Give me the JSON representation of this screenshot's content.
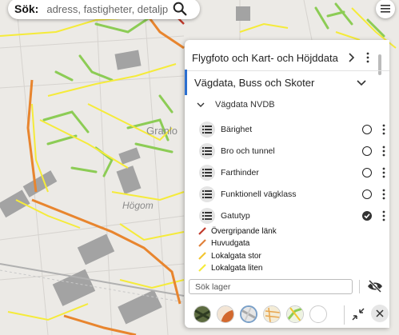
{
  "search": {
    "label": "Sök:",
    "placeholder": "adress, fastigheter, detaljplaner"
  },
  "map": {
    "place_labels": [
      "Granlo",
      "Högom"
    ],
    "colors": {
      "background": "#eceae6",
      "building": "#9c9c9c",
      "road_yellow": "#f5eb3a",
      "road_orange": "#f0a040",
      "road_red": "#c0392b",
      "vegetation_green": "#8ccc55",
      "accent_blue": "#2b6fd0"
    }
  },
  "panel": {
    "groups": [
      {
        "label": "Flygfoto och Kart- och Höjddata",
        "icon": "chevron-right-icon"
      },
      {
        "label": "Vägdata, Buss och Skoter",
        "icon": "chevron-down-icon"
      }
    ],
    "subgroup": {
      "label": "Vägdata NVDB",
      "icon": "chevron-down-icon"
    },
    "layers": [
      {
        "label": "Bärighet",
        "checked": false
      },
      {
        "label": "Bro och tunnel",
        "checked": false
      },
      {
        "label": "Farthinder",
        "checked": false
      },
      {
        "label": "Funktionell vägklass",
        "checked": false
      },
      {
        "label": "Gatutyp",
        "checked": true
      }
    ],
    "legend": [
      {
        "label": "Övergripande länk",
        "color": "#c0392b"
      },
      {
        "label": "Huvudgata",
        "color": "#e0803a"
      },
      {
        "label": "Lokalgata stor",
        "color": "#f2c531"
      },
      {
        "label": "Lokalgata liten",
        "color": "#f5eb3a"
      }
    ],
    "search_layers_placeholder": "Sök lager",
    "basemaps": [
      {
        "name": "satellite",
        "selected": false
      },
      {
        "name": "orange-map",
        "selected": false
      },
      {
        "name": "gray-map",
        "selected": true
      },
      {
        "name": "topo-map",
        "selected": false
      },
      {
        "name": "green-map",
        "selected": false
      },
      {
        "name": "blank-map",
        "selected": false
      }
    ]
  }
}
